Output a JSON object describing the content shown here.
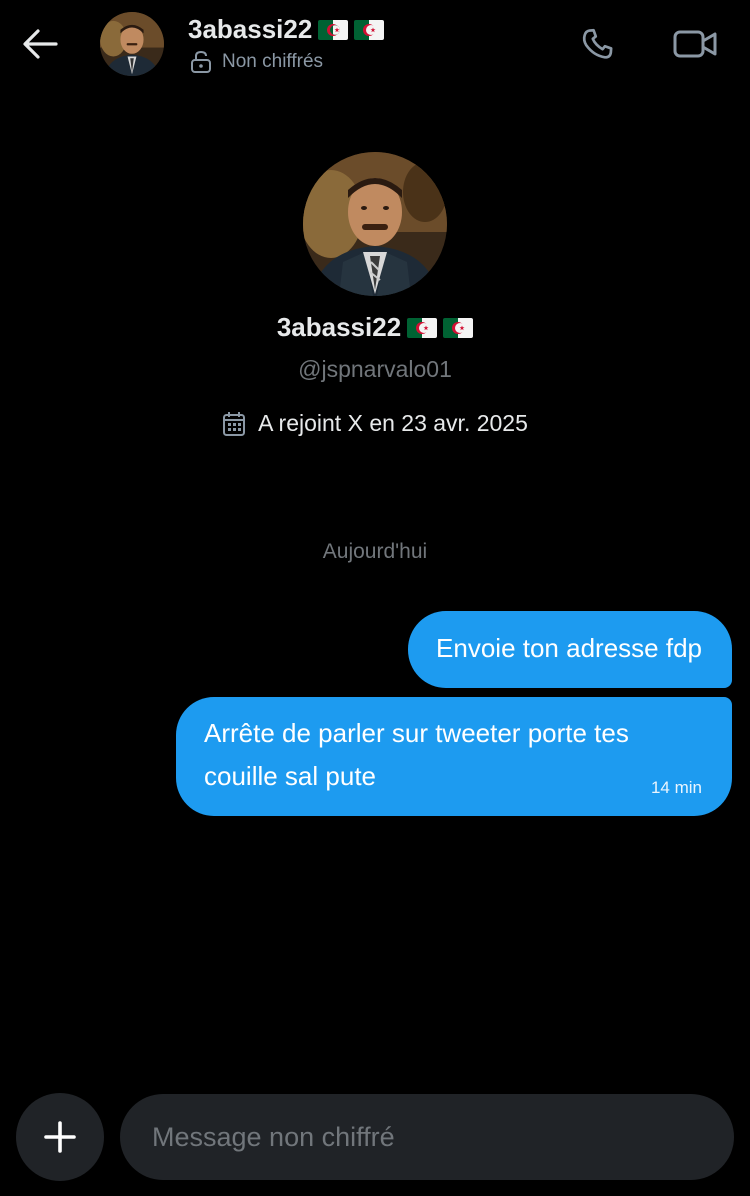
{
  "header": {
    "name": "3abassi22",
    "encryption_status": "Non chiffrés",
    "icons": [
      "back-arrow-icon",
      "lock-open-icon",
      "phone-icon",
      "video-camera-icon"
    ]
  },
  "profile": {
    "name": "3abassi22",
    "handle": "@jspnarvalo01",
    "joined": "A rejoint X en 23 avr. 2025",
    "icons": [
      "calendar-icon",
      "algeria-flag-icon"
    ]
  },
  "conversation": {
    "date_separator": "Aujourd'hui",
    "messages": [
      {
        "text": "Envoie ton adresse fdp",
        "outgoing": true
      },
      {
        "text": "Arrête de parler sur tweeter porte tes couille sal pute",
        "outgoing": true,
        "time": "14 min"
      }
    ]
  },
  "composer": {
    "placeholder": "Message non chiffré",
    "icons": [
      "plus-icon"
    ]
  },
  "colors": {
    "background": "#000000",
    "bubble": "#1d9bf0",
    "secondary_text": "#71767b",
    "composer_bg": "#202327"
  }
}
